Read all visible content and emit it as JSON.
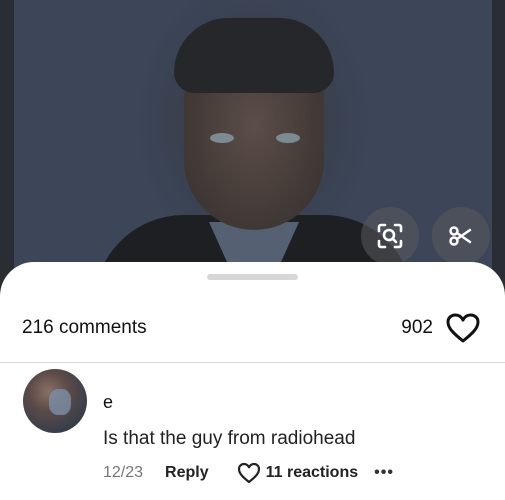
{
  "image": {
    "description_icons": [
      "visual-search-icon",
      "scissors-icon"
    ]
  },
  "sheet": {
    "comments_label": "216 comments",
    "likes_count": "902"
  },
  "comment": {
    "author": "e",
    "text": "Is that the guy from radiohead",
    "date": "12/23",
    "reply_label": "Reply",
    "reactions_label": "11 reactions",
    "more_label": "•••"
  },
  "colors": {
    "sheet_background": "#ffffff",
    "divider": "#d9d9d9",
    "handle": "#d7d7d7",
    "secondary_text": "#777777"
  }
}
